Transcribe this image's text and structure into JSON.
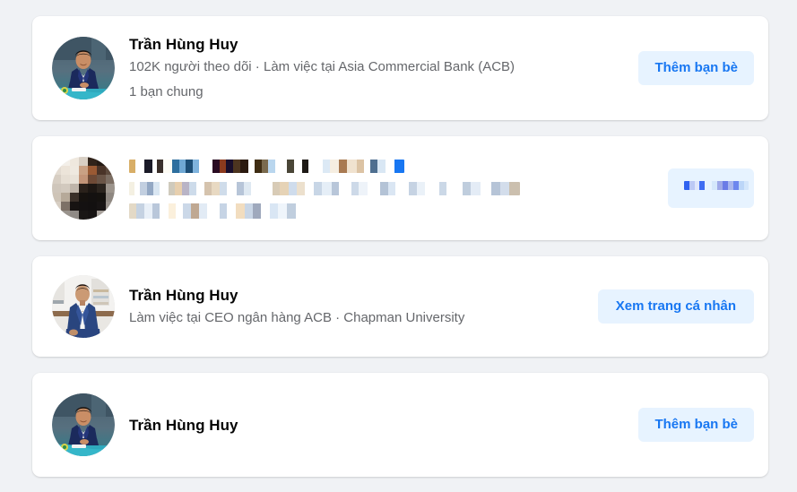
{
  "theme": {
    "page_background": "#f0f2f5",
    "card_background": "#ffffff",
    "primary_text": "#050505",
    "secondary_text": "#65676b",
    "button_background": "#e7f3ff",
    "button_text": "#1877f2"
  },
  "results": [
    {
      "id": "result-1",
      "name": "Trần Hùng Huy",
      "subtitle": "102K người theo dõi · Làm việc tại Asia Commercial Bank (ACB)",
      "mutual": "1 bạn chung",
      "action_label": "Thêm bạn bè",
      "avatar": "portrait-man-navy-suit-teal-foreground",
      "censored": false
    },
    {
      "id": "result-2",
      "name": "",
      "subtitle": "",
      "mutual": "",
      "action_label": "",
      "avatar": "portrait-censored-pixelated",
      "censored": true
    },
    {
      "id": "result-3",
      "name": "Trần Hùng Huy",
      "subtitle": "Làm việc tại CEO ngân hàng ACB · Chapman University",
      "mutual": "",
      "action_label": "Xem trang cá nhân",
      "avatar": "portrait-man-blue-suit-office-background",
      "censored": false
    },
    {
      "id": "result-4",
      "name": "Trần Hùng Huy",
      "subtitle": "",
      "mutual": "",
      "action_label": "Thêm bạn bè",
      "avatar": "portrait-man-navy-suit-teal-foreground",
      "censored": false
    }
  ]
}
